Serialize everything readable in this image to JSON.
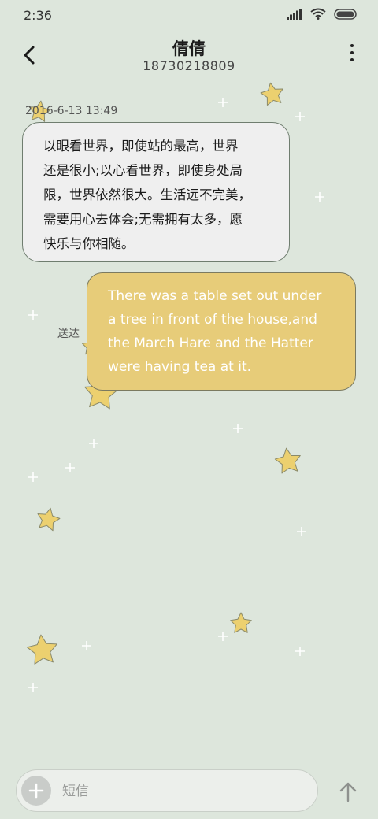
{
  "status_bar": {
    "time": "2:36",
    "icons": [
      "signal-icon",
      "wifi-icon",
      "battery-icon"
    ]
  },
  "header": {
    "contact_name": "倩倩",
    "contact_number": "18730218809"
  },
  "messages": [
    {
      "direction": "incoming",
      "timestamp": "2016-6-13 13:49",
      "lines": [
        "以眼看世界，即使站的最高，世界",
        "还是很小;以心看世界，即使身处局",
        "限，世界依然很大。生活远不完美，",
        "需要用心去体会;无需拥有太多，愿",
        "快乐与你相随。"
      ]
    },
    {
      "direction": "outgoing",
      "lines": [
        "There was a table set out under",
        "a tree in front of the house,and",
        "the March Hare and the Hatter",
        "were having tea at it."
      ],
      "status": "送达"
    }
  ],
  "composer": {
    "placeholder": "短信"
  },
  "colors": {
    "background": "#dde6dc",
    "incoming_bubble": "#efefef",
    "outgoing_bubble": "#e7cc79",
    "star": "#ecd06f"
  }
}
